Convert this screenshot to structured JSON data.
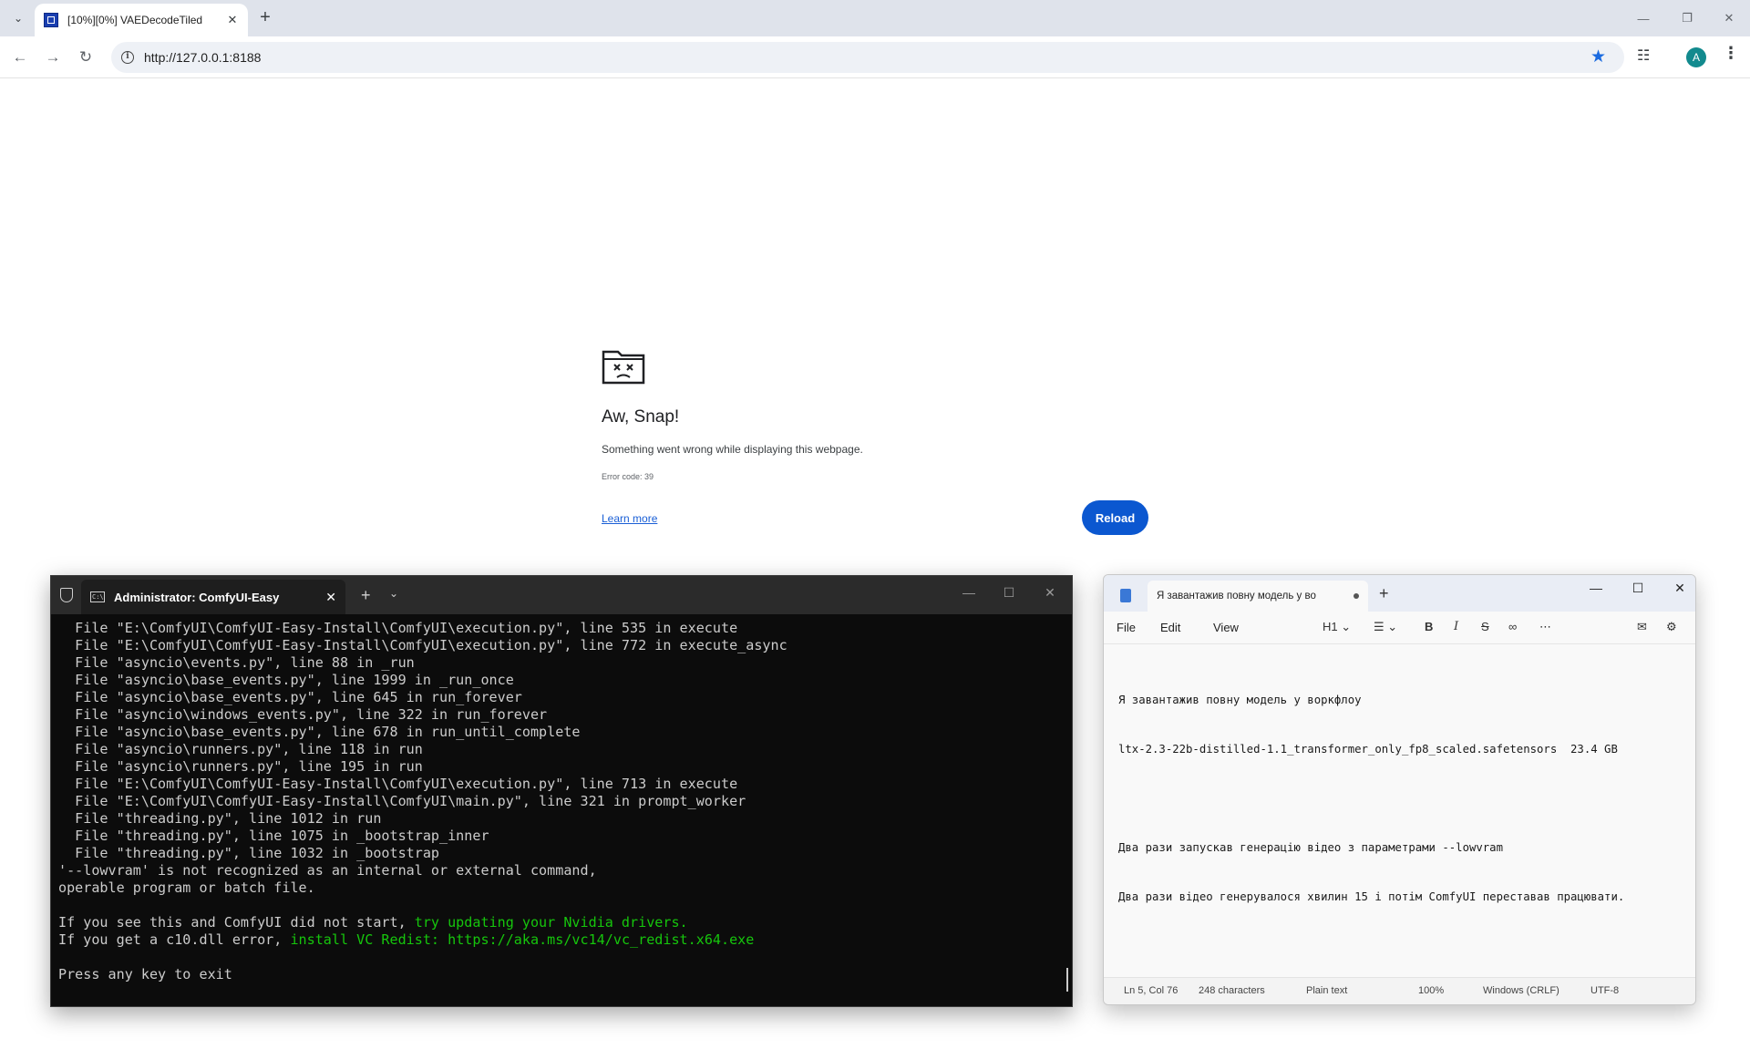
{
  "browser": {
    "tab_title": "[10%][0%] VAEDecodeTiled",
    "new_tab": "+",
    "url": "http://127.0.0.1:8188",
    "profile_initial": "A"
  },
  "error_page": {
    "title": "Aw, Snap!",
    "message": "Something went wrong while displaying this webpage.",
    "error_code": "Error code: 39",
    "learn_more": "Learn more",
    "reload": "Reload"
  },
  "terminal": {
    "tab_title": "Administrator: ComfyUI-Easy",
    "lines": [
      {
        "text": "  File \"E:\\ComfyUI\\ComfyUI-Easy-Install\\ComfyUI\\execution.py\", line 535 in execute",
        "hl": ""
      },
      {
        "text": "  File \"E:\\ComfyUI\\ComfyUI-Easy-Install\\ComfyUI\\execution.py\", line 772 in execute_async",
        "hl": ""
      },
      {
        "text": "  File \"asyncio\\events.py\", line 88 in _run",
        "hl": ""
      },
      {
        "text": "  File \"asyncio\\base_events.py\", line 1999 in _run_once",
        "hl": ""
      },
      {
        "text": "  File \"asyncio\\base_events.py\", line 645 in run_forever",
        "hl": ""
      },
      {
        "text": "  File \"asyncio\\windows_events.py\", line 322 in run_forever",
        "hl": ""
      },
      {
        "text": "  File \"asyncio\\base_events.py\", line 678 in run_until_complete",
        "hl": ""
      },
      {
        "text": "  File \"asyncio\\runners.py\", line 118 in run",
        "hl": ""
      },
      {
        "text": "  File \"asyncio\\runners.py\", line 195 in run",
        "hl": ""
      },
      {
        "text": "  File \"E:\\ComfyUI\\ComfyUI-Easy-Install\\ComfyUI\\execution.py\", line 713 in execute",
        "hl": ""
      },
      {
        "text": "  File \"E:\\ComfyUI\\ComfyUI-Easy-Install\\ComfyUI\\main.py\", line 321 in prompt_worker",
        "hl": ""
      },
      {
        "text": "  File \"threading.py\", line 1012 in run",
        "hl": ""
      },
      {
        "text": "  File \"threading.py\", line 1075 in _bootstrap_inner",
        "hl": ""
      },
      {
        "text": "  File \"threading.py\", line 1032 in _bootstrap",
        "hl": ""
      },
      {
        "text": "'--lowvram' is not recognized as an internal or external command,",
        "hl": ""
      },
      {
        "text": "operable program or batch file.",
        "hl": ""
      },
      {
        "text": "",
        "hl": ""
      },
      {
        "text": "If you see this and ComfyUI did not start, ",
        "hl": "try updating your Nvidia drivers."
      },
      {
        "text": "If you get a c10.dll error, ",
        "hl": "install VC Redist: https://aka.ms/vc14/vc_redist.x64.exe"
      },
      {
        "text": "",
        "hl": ""
      },
      {
        "text": "Press any key to exit",
        "hl": ""
      }
    ]
  },
  "notepad": {
    "tab_title": "Я завантажив повну модель у во",
    "menu": [
      "File",
      "Edit",
      "View"
    ],
    "heading_select": "H1",
    "lines": [
      "Я завантажив повну модель у воркфлоу",
      "ltx-2.3-22b-distilled-1.1_transformer_only_fp8_scaled.safetensors  23.4 GB",
      "",
      "Два рази запускав генерацію відео з параметрами --lowvram",
      "Два рази відео генерувалося хвилин 15 і потім ComfyUI переставав працювати."
    ],
    "status": {
      "position": "Ln 5, Col 76",
      "characters": "248 characters",
      "format": "Plain text",
      "zoom": "100%",
      "line_ending": "Windows (CRLF)",
      "encoding": "UTF-8"
    }
  }
}
